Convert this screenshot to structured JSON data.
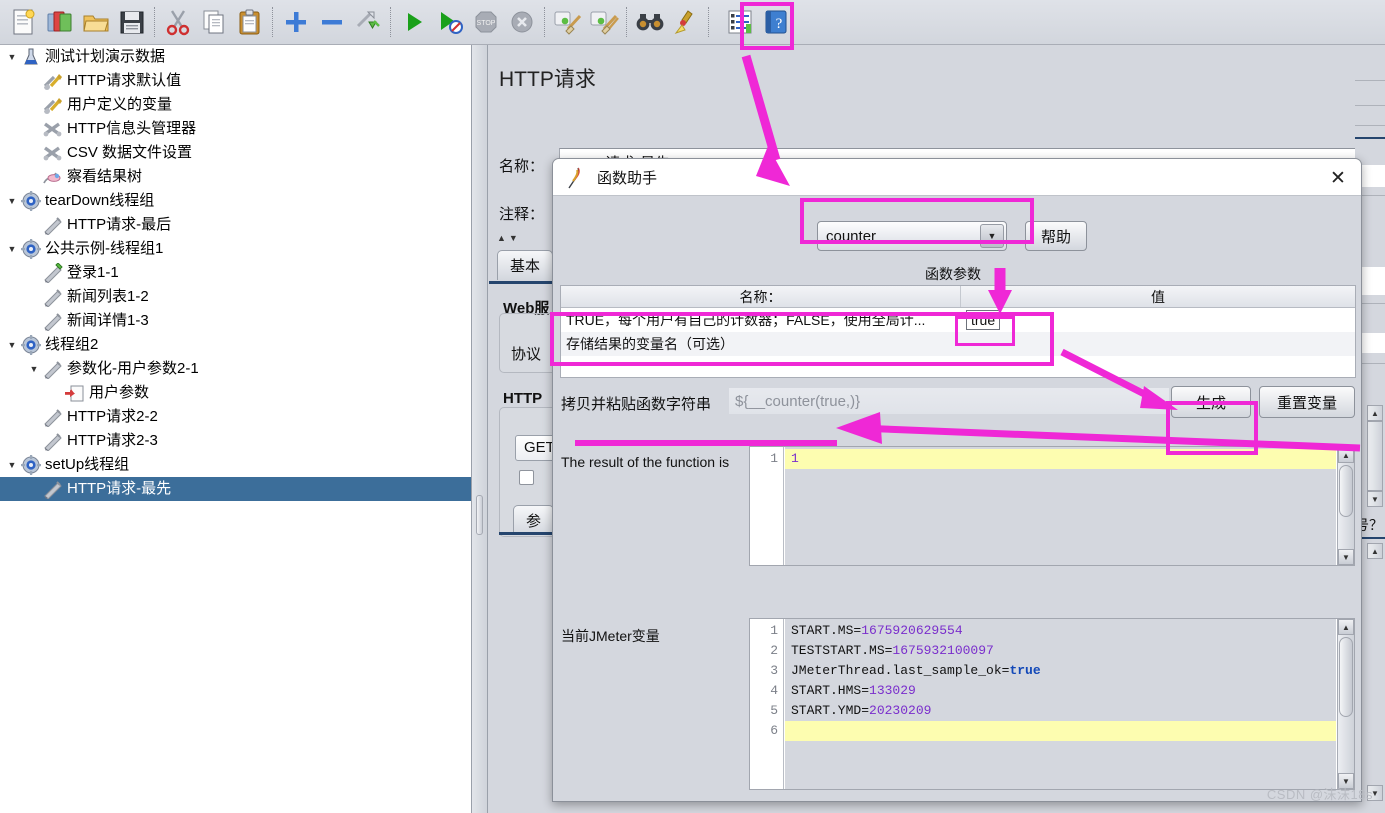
{
  "toolbar": {
    "buttons": [
      {
        "name": "new-icon",
        "label": "新建"
      },
      {
        "name": "templates-icon",
        "label": "模板"
      },
      {
        "name": "open-icon",
        "label": "打开"
      },
      {
        "name": "save-icon",
        "label": "保存"
      },
      {
        "name": "cut-icon",
        "label": "剪切"
      },
      {
        "name": "copy-icon",
        "label": "复制"
      },
      {
        "name": "paste-icon",
        "label": "粘贴"
      },
      {
        "name": "expand-all-icon",
        "label": "展开全部"
      },
      {
        "name": "collapse-all-icon",
        "label": "收起全部"
      },
      {
        "name": "toggle-icon",
        "label": "切换"
      },
      {
        "name": "start-icon",
        "label": "启动"
      },
      {
        "name": "start-no-pauses-icon",
        "label": "无间隔启动"
      },
      {
        "name": "stop-icon",
        "label": "停止"
      },
      {
        "name": "shutdown-icon",
        "label": "关闭"
      },
      {
        "name": "clear-icon",
        "label": "清除"
      },
      {
        "name": "clear-all-icon",
        "label": "清除全部"
      },
      {
        "name": "search-icon",
        "label": "搜索"
      },
      {
        "name": "reset-search-icon",
        "label": "重置搜索"
      },
      {
        "name": "function-helper-icon",
        "label": "函数助手对话框"
      },
      {
        "name": "help-icon",
        "label": "帮助"
      }
    ]
  },
  "tree": {
    "items": [
      {
        "label": "测试计划演示数据",
        "indent": 0,
        "twisty": "▼",
        "icon": "test-plan-icon",
        "selected": false
      },
      {
        "label": "HTTP请求默认值",
        "indent": 1,
        "twisty": "",
        "icon": "config-element-icon",
        "selected": false
      },
      {
        "label": "用户定义的变量",
        "indent": 1,
        "twisty": "",
        "icon": "config-element-icon",
        "selected": false
      },
      {
        "label": "HTTP信息头管理器",
        "indent": 1,
        "twisty": "",
        "icon": "header-manager-icon",
        "selected": false
      },
      {
        "label": "CSV 数据文件设置",
        "indent": 1,
        "twisty": "",
        "icon": "csv-dataset-icon",
        "selected": false
      },
      {
        "label": "察看结果树",
        "indent": 1,
        "twisty": "",
        "icon": "view-results-tree-icon",
        "selected": false
      },
      {
        "label": "tearDown线程组",
        "indent": 0,
        "twisty": "▼",
        "icon": "thread-group-icon",
        "selected": false
      },
      {
        "label": "HTTP请求-最后",
        "indent": 1,
        "twisty": "",
        "icon": "http-sampler-icon",
        "selected": false
      },
      {
        "label": "公共示例-线程组1",
        "indent": 0,
        "twisty": "▼",
        "icon": "thread-group-icon",
        "selected": false
      },
      {
        "label": "登录1-1",
        "indent": 1,
        "twisty": "",
        "icon": "http-sampler-green-icon",
        "selected": false
      },
      {
        "label": "新闻列表1-2",
        "indent": 1,
        "twisty": "",
        "icon": "http-sampler-icon",
        "selected": false
      },
      {
        "label": "新闻详情1-3",
        "indent": 1,
        "twisty": "",
        "icon": "http-sampler-icon",
        "selected": false
      },
      {
        "label": "线程组2",
        "indent": 0,
        "twisty": "▼",
        "icon": "thread-group-icon",
        "selected": false
      },
      {
        "label": "参数化-用户参数2-1",
        "indent": 1,
        "twisty": "▼",
        "icon": "http-sampler-icon",
        "selected": false
      },
      {
        "label": "用户参数",
        "indent": 2,
        "twisty": "",
        "icon": "user-parameters-icon",
        "selected": false
      },
      {
        "label": "HTTP请求2-2",
        "indent": 1,
        "twisty": "",
        "icon": "http-sampler-icon",
        "selected": false
      },
      {
        "label": "HTTP请求2-3",
        "indent": 1,
        "twisty": "",
        "icon": "http-sampler-icon",
        "selected": false
      },
      {
        "label": "setUp线程组",
        "indent": 0,
        "twisty": "▼",
        "icon": "thread-group-icon",
        "selected": false
      },
      {
        "label": "HTTP请求-最先",
        "indent": 1,
        "twisty": "",
        "icon": "http-sampler-icon",
        "selected": true
      }
    ]
  },
  "request_panel": {
    "title": "HTTP请求",
    "name_label": "名称：",
    "name_value": "HTTP请求-最先",
    "comment_label": "注释：",
    "comment_value": "",
    "tab_basic": "基本",
    "web_server_label": "Web服",
    "protocol_label": "协议",
    "http_request_label": "HTTP",
    "method_value": "GET",
    "params_tab": "参",
    "edge_text": "号？"
  },
  "dialog": {
    "title": "函数助手",
    "title_icon": "jmeter-feather-icon",
    "close_icon": "close-icon",
    "function_select": "counter",
    "help_button": "帮助",
    "args_title": "函数参数",
    "table": {
      "headers": [
        "名称：",
        "值"
      ],
      "rows": [
        {
          "name": "TRUE，每个用户有自己的计数器；FALSE，使用全局计...",
          "value": "true"
        },
        {
          "name": "存储结果的变量名（可选）",
          "value": ""
        }
      ]
    },
    "copy_label": "拷贝并粘贴函数字符串",
    "copy_value": "${__counter(true,)}",
    "generate_button": "生成",
    "reset_button": "重置变量",
    "result_label": "The result of the function is",
    "result_lines": [
      "1"
    ],
    "vars_label": "当前JMeter变量",
    "vars_lines": [
      {
        "n": 1,
        "key": "START.MS",
        "val": "1675920629554",
        "type": "num"
      },
      {
        "n": 2,
        "key": "TESTSTART.MS",
        "val": "1675932100097",
        "type": "num"
      },
      {
        "n": 3,
        "key": "JMeterThread.last_sample_ok",
        "val": "true",
        "type": "bool"
      },
      {
        "n": 4,
        "key": "START.HMS",
        "val": "133029",
        "type": "num"
      },
      {
        "n": 5,
        "key": "START.YMD",
        "val": "20230209",
        "type": "num"
      },
      {
        "n": 6,
        "key": "",
        "val": "",
        "type": "empty"
      }
    ]
  },
  "annotations": {
    "accent_color": "#ef28d6"
  },
  "watermark": "CSDN @沫沫18s"
}
